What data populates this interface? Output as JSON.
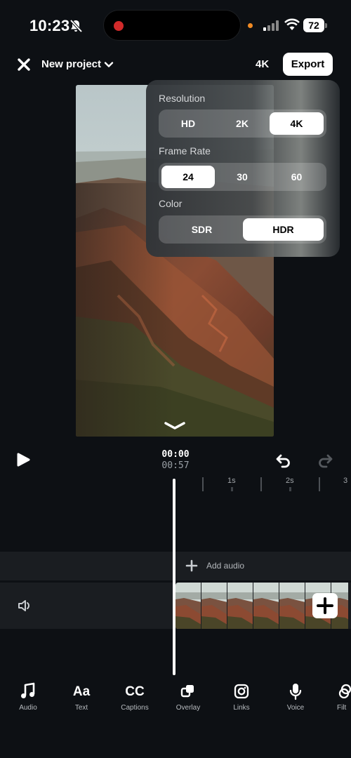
{
  "status_bar": {
    "time": "10:23",
    "battery": "72"
  },
  "header": {
    "project_title": "New project",
    "resolution": "4K",
    "export_label": "Export"
  },
  "settings": {
    "resolution": {
      "label": "Resolution",
      "options": [
        "HD",
        "2K",
        "4K"
      ],
      "selected": "4K"
    },
    "frame_rate": {
      "label": "Frame Rate",
      "options": [
        "24",
        "30",
        "60"
      ],
      "selected": "24"
    },
    "color": {
      "label": "Color",
      "options": [
        "SDR",
        "HDR"
      ],
      "selected": "HDR"
    }
  },
  "playback": {
    "current_time": "00:00",
    "total_time": "00:57"
  },
  "timeline": {
    "tick_labels": [
      "1s",
      "2s",
      "3"
    ]
  },
  "audio_track": {
    "add_label": "Add audio"
  },
  "toolbar": {
    "items": [
      {
        "label": "Audio",
        "icon": "music-note-icon"
      },
      {
        "label": "Text",
        "icon": "text-icon",
        "glyph": "Aa"
      },
      {
        "label": "Captions",
        "icon": "captions-icon",
        "glyph": "CC"
      },
      {
        "label": "Overlay",
        "icon": "overlay-icon"
      },
      {
        "label": "Links",
        "icon": "instagram-icon"
      },
      {
        "label": "Voice",
        "icon": "microphone-icon"
      },
      {
        "label": "Filt",
        "icon": "filter-icon"
      }
    ]
  },
  "colors": {
    "background": "#0d1014",
    "track": "#1a1d21",
    "recording": "#d12a2a"
  }
}
